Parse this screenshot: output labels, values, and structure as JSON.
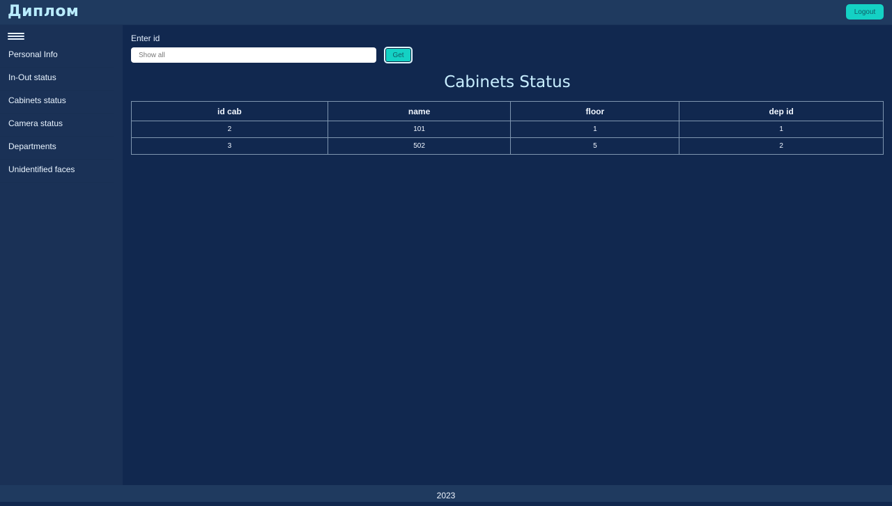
{
  "header": {
    "brand": "Диплом",
    "logout_label": "Logout"
  },
  "sidebar": {
    "menu_icon": "hamburger-menu-icon",
    "items": [
      {
        "label": "Personal Info"
      },
      {
        "label": "In-Out status"
      },
      {
        "label": "Cabinets status"
      },
      {
        "label": "Camera status"
      },
      {
        "label": "Departments"
      },
      {
        "label": "Unidentified faces"
      }
    ]
  },
  "main": {
    "enter_label": "Enter id",
    "input_value": "",
    "input_placeholder": "Show all",
    "get_label": "Get",
    "title": "Cabinets Status",
    "table": {
      "columns": [
        "id cab",
        "name",
        "floor",
        "dep id"
      ],
      "rows": [
        [
          "2",
          "101",
          "1",
          "1"
        ],
        [
          "3",
          "502",
          "5",
          "2"
        ]
      ]
    }
  },
  "footer": {
    "text": "2023"
  },
  "colors": {
    "background": "#11284f",
    "sidebar": "#1a3156",
    "header": "#1f3a5f",
    "accent": "#14d1c4",
    "brand": "#b9ecff"
  }
}
